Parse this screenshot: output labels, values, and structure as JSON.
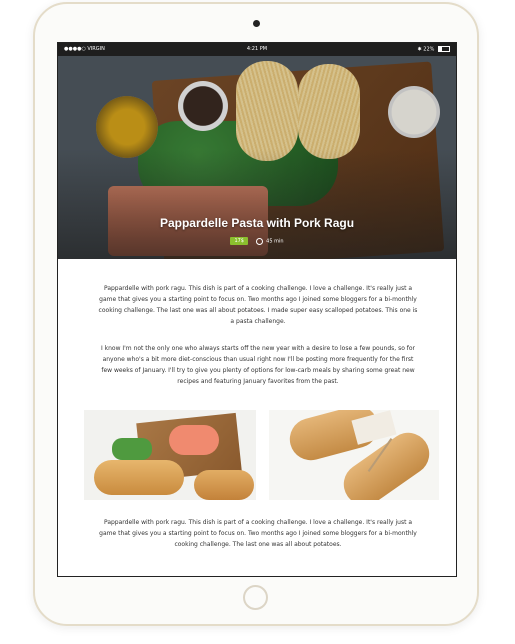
{
  "status_bar": {
    "carrier": "●●●●○ VIRGIN",
    "wifi": "wifi-icon",
    "time": "4:21 PM",
    "bluetooth": "bluetooth-icon",
    "battery": "22%"
  },
  "hero": {
    "title": "Pappardelle Pasta with Pork Ragu",
    "badge": "17$",
    "duration": "45 min",
    "colors": {
      "badge": "#8bbf2e"
    }
  },
  "article": {
    "paragraph1": "Pappardelle with pork ragu. This dish is part of a cooking challenge. I love a challenge. It's really just a game that gives you a starting point to focus on. Two months ago I joined some bloggers for a bi-monthly cooking challenge. The last one was all about potatoes. I made super easy scalloped potatoes. This one is a pasta challenge.",
    "paragraph2": "I know I'm not the only one who always starts off the new year with a desire to lose a few pounds, so for anyone who's a bit more diet-conscious than usual right now I'll be posting more frequently for the first few weeks of January. I'll try to give you plenty of options for low-carb meals by sharing some great new recipes and featuring January favorites from the past.",
    "paragraph3": "Pappardelle with pork ragu. This dish is part of a cooking challenge. I love a challenge. It's really just a game that gives you a starting point to focus on. Two months ago I joined some bloggers for a bi-monthly cooking challenge. The last one was all about potatoes."
  }
}
